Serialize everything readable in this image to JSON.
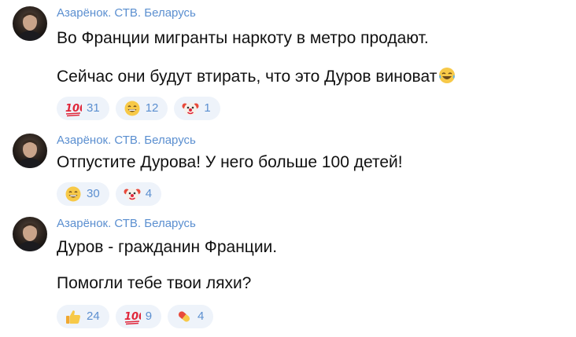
{
  "messages": [
    {
      "author": "Азарёнок. СТВ. Беларусь",
      "lines": [
        "Во Франции мигранты наркоту в метро продают.",
        "",
        "Сейчас они будут втирать, что это Дуров виноват"
      ],
      "reactions": [
        {
          "emoji": "hundred-points-icon",
          "count": "31"
        },
        {
          "emoji": "grinning-face-icon",
          "count": "12"
        },
        {
          "emoji": "clown-face-icon",
          "count": "1"
        }
      ]
    },
    {
      "author": "Азарёнок. СТВ. Беларусь",
      "lines": [
        "Отпустите Дурова! У него больше 100 детей!"
      ],
      "reactions": [
        {
          "emoji": "grinning-face-icon",
          "count": "30"
        },
        {
          "emoji": "clown-face-icon",
          "count": "4"
        }
      ]
    },
    {
      "author": "Азарёнок. СТВ. Беларусь",
      "lines": [
        "Дуров - гражданин Франции.",
        "",
        "Помогли тебе твои ляхи?"
      ],
      "reactions": [
        {
          "emoji": "thumbs-up-icon",
          "count": "24"
        },
        {
          "emoji": "hundred-points-icon",
          "count": "9"
        },
        {
          "emoji": "pill-icon",
          "count": "4"
        }
      ]
    }
  ],
  "colors": {
    "author": "#5b8fd0",
    "text": "#111111",
    "chip_bg": "#eef3fa",
    "count": "#5b8fd0"
  }
}
